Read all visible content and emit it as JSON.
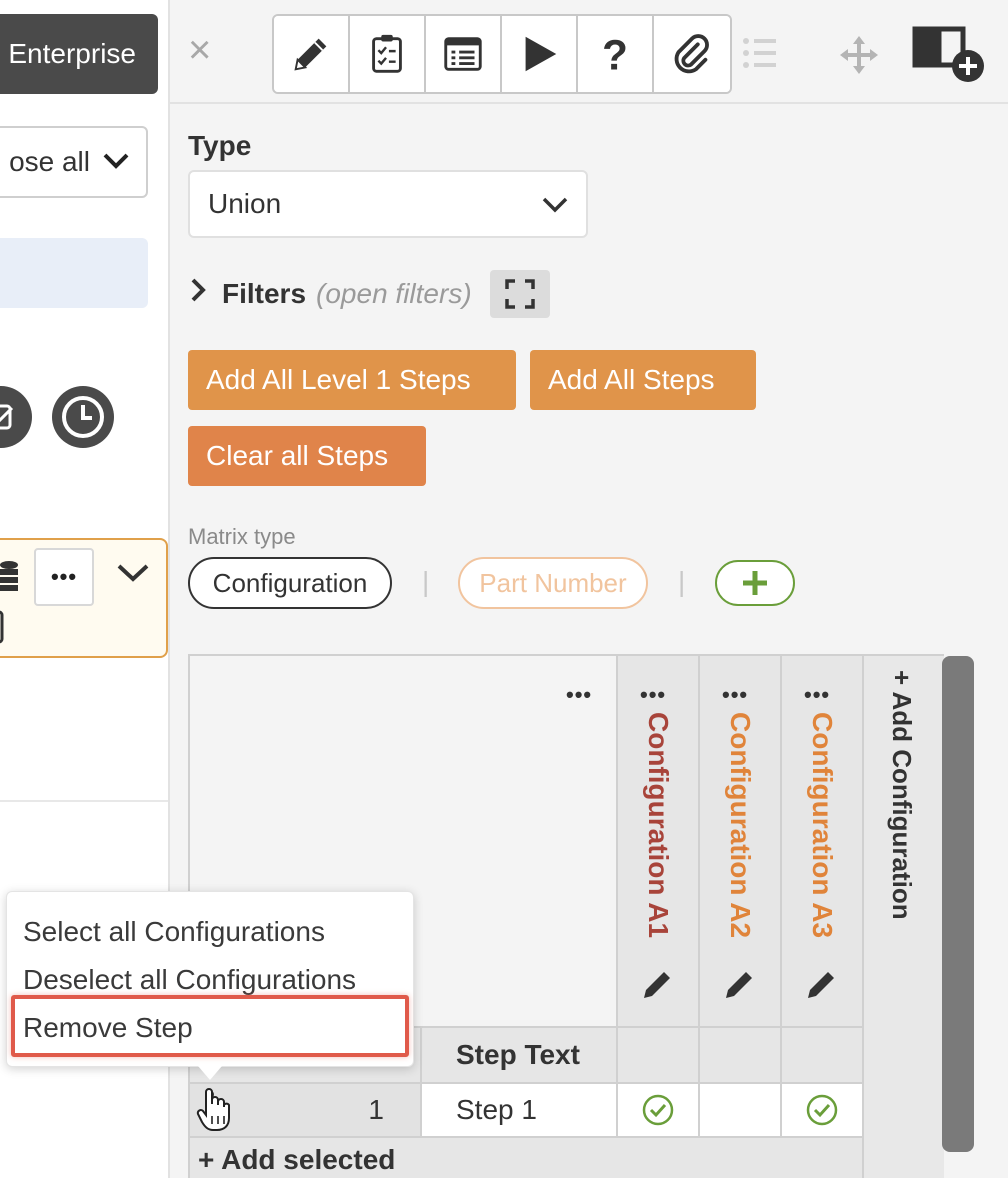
{
  "left_panel": {
    "enterprise_label": "Enterprise",
    "collapse_label": "ose all",
    "more_label": "•••"
  },
  "toolbar": {
    "close_label": "×",
    "tools": [
      "edit-icon",
      "checklist-icon",
      "form-icon",
      "play-icon",
      "help-icon",
      "attachment-icon"
    ],
    "extra": [
      "list-icon",
      "move-icon",
      "add-column-icon"
    ]
  },
  "type_field": {
    "label": "Type",
    "value": "Union"
  },
  "filters": {
    "label": "Filters",
    "hint": "(open filters)"
  },
  "buttons": {
    "add_level1": "Add All Level 1 Steps",
    "add_all": "Add All Steps",
    "clear_all": "Clear all Steps"
  },
  "matrix_type": {
    "label": "Matrix type",
    "selected": "Configuration",
    "other": "Part Number",
    "separator": "|",
    "add_label": "+"
  },
  "matrix": {
    "corner_dots": "•••",
    "columns": [
      {
        "name": "Configuration A1",
        "color": "#a8443a"
      },
      {
        "name": "Configuration A2",
        "color": "#e0843a"
      },
      {
        "name": "Configuration A3",
        "color": "#e0843a"
      }
    ],
    "col_dots": "•••",
    "add_configuration": "+ Add Configuration",
    "header_step_text": "Step Text",
    "rows": [
      {
        "number": "1",
        "text": "Step 1",
        "checks": [
          true,
          false,
          true
        ]
      }
    ],
    "add_selected": "+ Add selected"
  },
  "context_menu": {
    "items": [
      "Select all Configurations",
      "Deselect all Configurations",
      "Remove Step"
    ],
    "highlighted": "Remove Step"
  },
  "colors": {
    "orange": "#e0944a",
    "green": "#6a9e3a",
    "highlight": "#e05a4a"
  }
}
